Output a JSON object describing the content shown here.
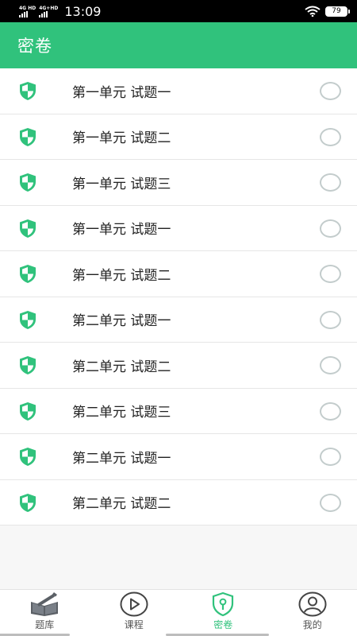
{
  "status_bar": {
    "network_1": "4G HD",
    "network_2": "4G+HD",
    "time": "13:09",
    "battery": "79",
    "icons": [
      "signal-icon",
      "signal-icon",
      "wifi-icon",
      "battery-icon"
    ]
  },
  "header": {
    "title": "密卷"
  },
  "list": {
    "items": [
      {
        "label": "第一单元 试题一",
        "icon": "shield-icon",
        "selected": false
      },
      {
        "label": "第一单元 试题二",
        "icon": "shield-icon",
        "selected": false
      },
      {
        "label": "第一单元 试题三",
        "icon": "shield-icon",
        "selected": false
      },
      {
        "label": "第一单元 试题一",
        "icon": "shield-icon",
        "selected": false
      },
      {
        "label": "第一单元 试题二",
        "icon": "shield-icon",
        "selected": false
      },
      {
        "label": "第二单元 试题一",
        "icon": "shield-icon",
        "selected": false
      },
      {
        "label": "第二单元 试题二",
        "icon": "shield-icon",
        "selected": false
      },
      {
        "label": "第二单元 试题三",
        "icon": "shield-icon",
        "selected": false
      },
      {
        "label": "第二单元 试题一",
        "icon": "shield-icon",
        "selected": false
      },
      {
        "label": "第二单元 试题二",
        "icon": "shield-icon",
        "selected": false
      }
    ]
  },
  "tab_bar": {
    "tabs": [
      {
        "label": "题库",
        "icon": "book-icon",
        "active": false
      },
      {
        "label": "课程",
        "icon": "play-circle-icon",
        "active": false
      },
      {
        "label": "密卷",
        "icon": "shield-keyhole-icon",
        "active": true
      },
      {
        "label": "我的",
        "icon": "user-icon",
        "active": false
      }
    ]
  },
  "colors": {
    "accent": "#30c27c",
    "radio_border": "#c3cccc",
    "background": "#f7f7f7"
  }
}
